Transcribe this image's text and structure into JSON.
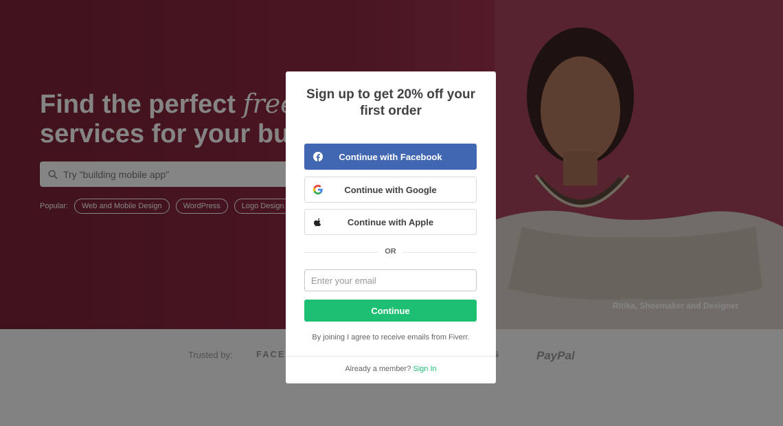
{
  "hero": {
    "title_line1_a": "Find the perfect ",
    "title_line1_b": "freelance",
    "title_line2": "services for your business",
    "search_placeholder": "Try \"building mobile app\"",
    "popular_label": "Popular:",
    "popular_tags": [
      "Web and Mobile Design",
      "WordPress",
      "Logo Design"
    ],
    "caption": "Ritika, Shoemaker and Designer"
  },
  "trusted": {
    "label": "Trusted by:",
    "logos": [
      "FACEBOOK",
      "G",
      "PayPal"
    ]
  },
  "modal": {
    "title": "Sign up to get 20% off your first order",
    "facebook_label": "Continue with Facebook",
    "google_label": "Continue with Google",
    "apple_label": "Continue with Apple",
    "or_label": "OR",
    "email_placeholder": "Enter your email",
    "continue_label": "Continue",
    "terms": "By joining I agree to receive emails from Fiverr.",
    "member_text": "Already a member?",
    "sign_in_label": "Sign In"
  },
  "colors": {
    "facebook": "#4267b2",
    "accent_green": "#1dbf73",
    "hero_bg": "#8e2a42"
  }
}
